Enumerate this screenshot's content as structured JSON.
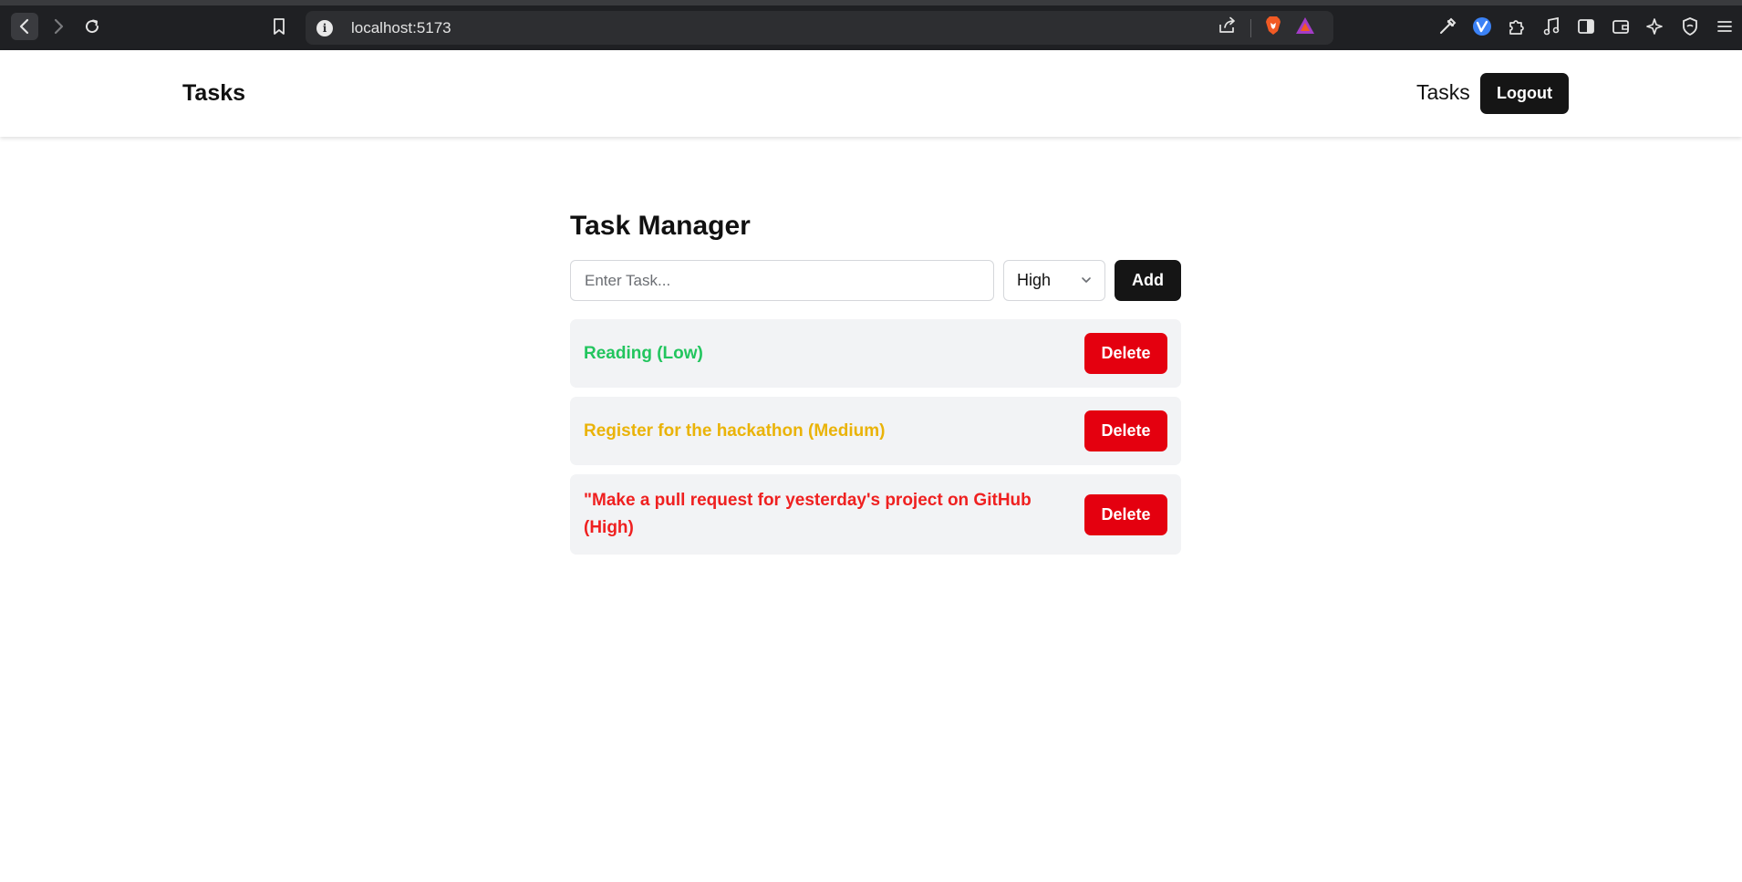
{
  "browser": {
    "url": "localhost:5173"
  },
  "header": {
    "brand": "Tasks",
    "nav_link": "Tasks",
    "logout_label": "Logout"
  },
  "main": {
    "title": "Task Manager",
    "input_placeholder": "Enter Task...",
    "input_value": "",
    "priority_selected": "High",
    "add_label": "Add",
    "tasks": [
      {
        "label": "Reading (Low)",
        "color": "#22c55e",
        "delete_label": "Delete"
      },
      {
        "label": "Register for the hackathon (Medium)",
        "color": "#eab308",
        "delete_label": "Delete"
      },
      {
        "label": "\"Make a pull request for yesterday's project on GitHub (High)",
        "color": "#ef2020",
        "delete_label": "Delete"
      }
    ]
  },
  "colors": {
    "chrome_bg": "#1f2023",
    "urlbar_bg": "#2d2e31",
    "primary_button": "#151515",
    "danger_button": "#e4000f",
    "task_bg": "#f2f3f5"
  }
}
